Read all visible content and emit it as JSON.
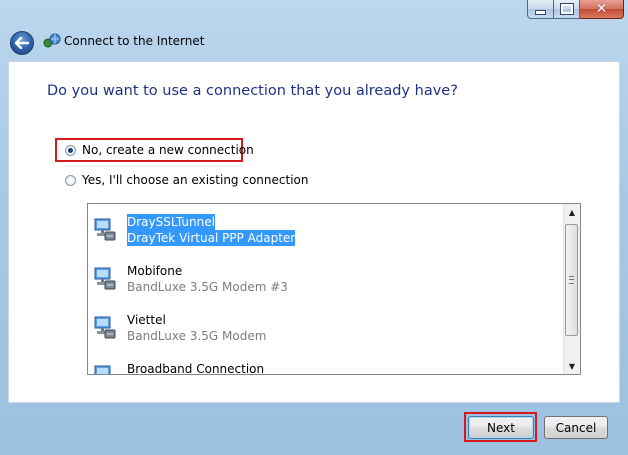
{
  "window": {
    "title": "Connect to the Internet",
    "close_glyph": "✕"
  },
  "page": {
    "heading": "Do you want to use a connection that you already have?"
  },
  "options": [
    {
      "label": "No, create a new connection",
      "selected": true
    },
    {
      "label": "Yes, I'll choose an existing connection",
      "selected": false
    }
  ],
  "connections": [
    {
      "name": "DraySSLTunnel",
      "device": "DrayTek Virtual PPP Adapter",
      "selected": true,
      "icon": "network-connection-icon"
    },
    {
      "name": "Mobifone",
      "device": "BandLuxe 3.5G Modem #3",
      "selected": false,
      "icon": "network-connection-icon"
    },
    {
      "name": "Viettel",
      "device": "BandLuxe 3.5G Modem",
      "selected": false,
      "icon": "network-connection-icon"
    },
    {
      "name": "Broadband Connection",
      "device": "",
      "selected": false,
      "icon": "network-connection-icon"
    }
  ],
  "buttons": {
    "next": "Next",
    "cancel": "Cancel"
  },
  "colors": {
    "heading": "#1e3287",
    "selection": "#3399ff",
    "highlight_box": "#d61a1a"
  }
}
